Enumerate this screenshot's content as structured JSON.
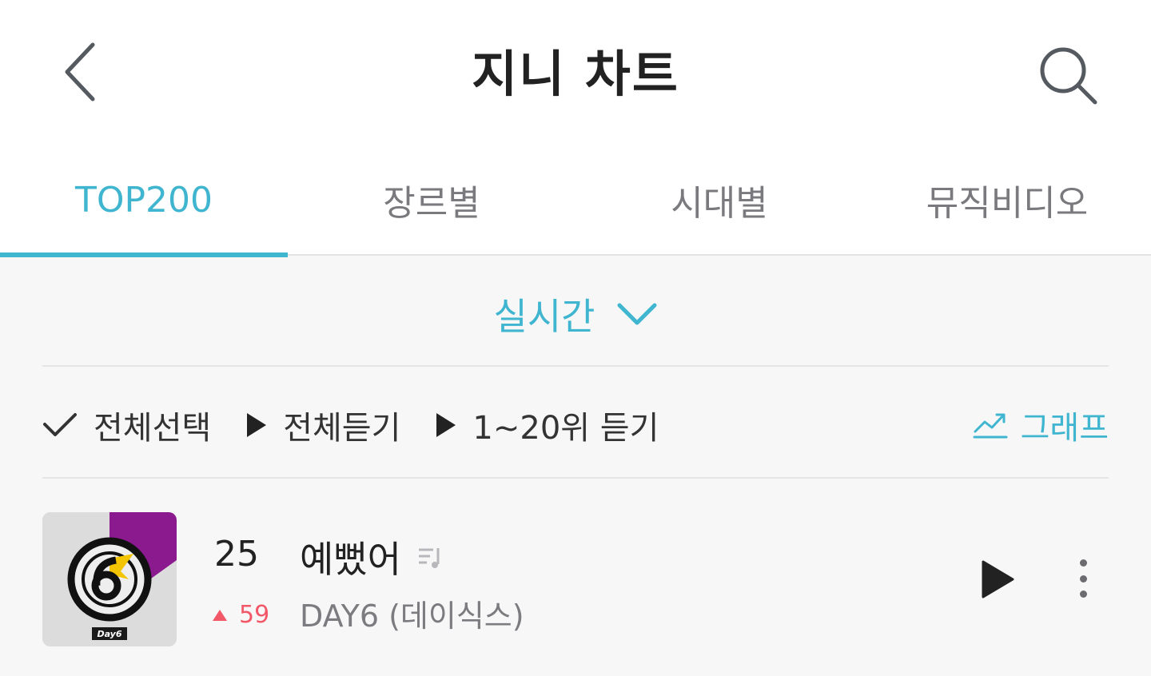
{
  "header": {
    "title": "지니 차트",
    "back_icon": "chevron-left-icon",
    "search_icon": "search-icon"
  },
  "tabs": [
    {
      "label": "TOP200",
      "active": true
    },
    {
      "label": "장르별",
      "active": false
    },
    {
      "label": "시대별",
      "active": false
    },
    {
      "label": "뮤직비디오",
      "active": false
    }
  ],
  "period": {
    "label": "실시간",
    "icon": "chevron-down-icon"
  },
  "toolbar": {
    "select_all": "전체선택",
    "play_all": "전체듣기",
    "play_top": "1~20위 듣기",
    "graph": "그래프"
  },
  "songs": [
    {
      "rank": "25",
      "change": "59",
      "change_direction": "up",
      "title": "예뻤어",
      "artist": "DAY6 (데이식스)",
      "album_logo_text": "Day6",
      "lyrics_icon": "lyrics-icon"
    }
  ],
  "colors": {
    "accent": "#3fb5cf",
    "rank_up": "#f25868",
    "text_primary": "#222222",
    "text_secondary": "#7b7b80"
  }
}
